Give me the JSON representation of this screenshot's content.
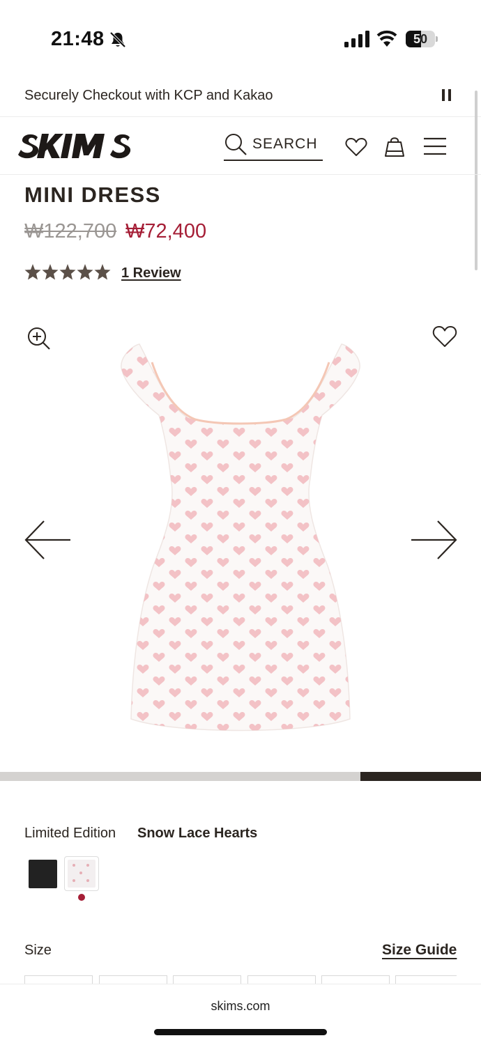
{
  "status_bar": {
    "time": "21:48",
    "battery": "50",
    "icons": [
      "bell-slash-icon",
      "signal-icon",
      "wifi-icon",
      "battery-icon"
    ]
  },
  "announcement": {
    "text": "Securely Checkout with KCP and Kakao",
    "control_icon": "pause-icon"
  },
  "header": {
    "logo": "SKIMS",
    "search_label": "SEARCH",
    "icons": [
      "search-icon",
      "heart-icon",
      "shopping-bag-icon",
      "menu-icon"
    ]
  },
  "product": {
    "title": "MINI DRESS",
    "price_original": "₩122,700",
    "price_sale": "₩72,400",
    "rating_stars": 5,
    "review_link": "1 Review"
  },
  "gallery": {
    "icons": [
      "zoom-in-icon",
      "heart-icon",
      "arrow-left-icon",
      "arrow-right-icon"
    ],
    "progress": 0.25
  },
  "color": {
    "label": "Limited Edition",
    "selected": "Snow Lace Hearts",
    "swatches": [
      "black",
      "snow-lace-hearts"
    ]
  },
  "size": {
    "label": "Size",
    "guide_link": "Size Guide"
  },
  "browser": {
    "url": "skims.com"
  },
  "colors": {
    "text": "#2b2520",
    "sale": "#a51e36",
    "muted": "#9a9693"
  }
}
